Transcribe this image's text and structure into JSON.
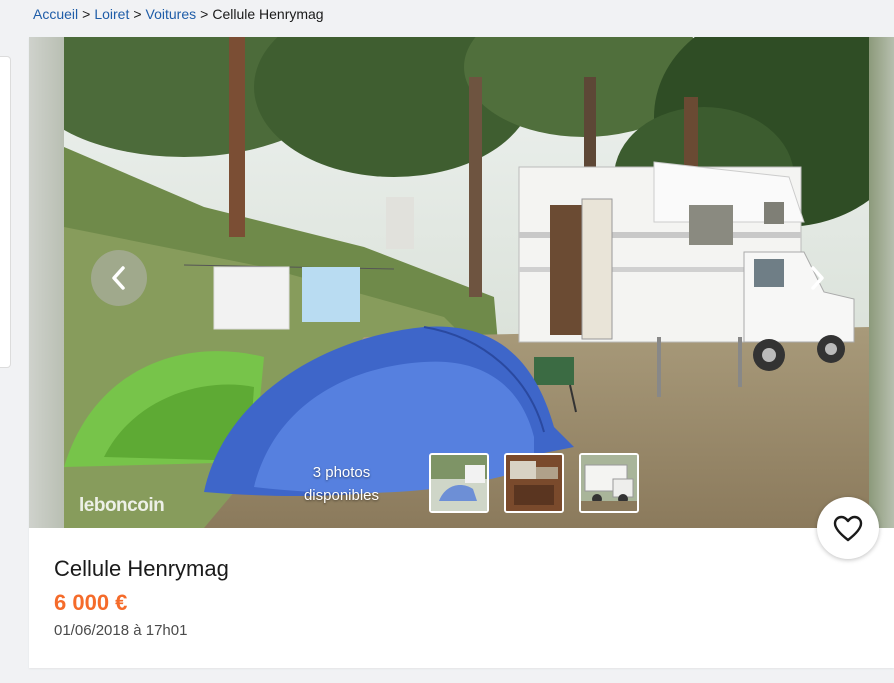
{
  "breadcrumb": {
    "home": "Accueil",
    "region": "Loiret",
    "category": "Voitures",
    "current": "Cellule Henrymag",
    "separator": ">"
  },
  "gallery": {
    "photo_count_text": "3 photos disponibles",
    "watermark": "leboncoin",
    "prev_icon": "chevron-left-icon",
    "next_icon": "chevron-right-icon",
    "thumbnails": [
      "tent-photo",
      "interior-photo",
      "camper-photo"
    ]
  },
  "listing": {
    "title": "Cellule Henrymag",
    "price": "6 000 €",
    "date": "01/06/2018 à 17h01"
  },
  "favorite": {
    "icon": "heart-icon"
  },
  "colors": {
    "link": "#1f5da8",
    "price": "#f56b2a"
  }
}
